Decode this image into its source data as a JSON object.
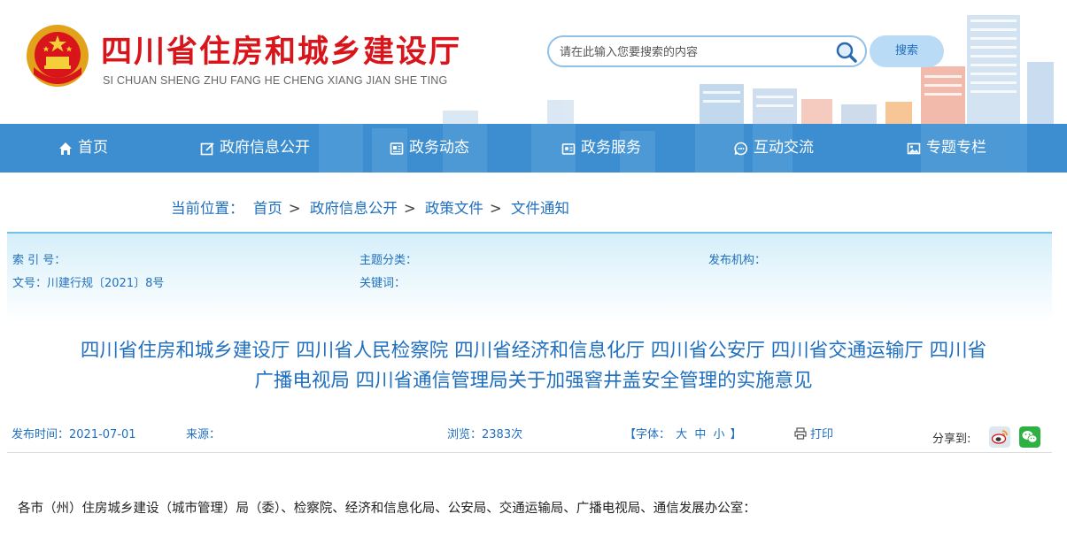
{
  "header": {
    "site_title": "四川省住房和城乡建设厅",
    "site_subtitle": "SI CHUAN SHENG ZHU FANG HE CHENG XIANG JIAN SHE TING",
    "search": {
      "placeholder": "请在此输入您要搜索的内容",
      "button_label": "搜索",
      "icon": "search-icon"
    },
    "emblem_icon": "national-emblem-icon"
  },
  "nav": {
    "items": [
      {
        "label": "首页",
        "icon": "home-icon"
      },
      {
        "label": "政府信息公开",
        "icon": "edit-icon"
      },
      {
        "label": "政务动态",
        "icon": "news-icon"
      },
      {
        "label": "政务服务",
        "icon": "service-icon"
      },
      {
        "label": "互动交流",
        "icon": "chat-icon"
      },
      {
        "label": "专题专栏",
        "icon": "image-icon"
      }
    ],
    "color": "#3c8ed0"
  },
  "breadcrumb": {
    "prefix": "当前位置：",
    "items": [
      "首页",
      "政府信息公开",
      "政策文件",
      "文件通知"
    ],
    "separator": ">"
  },
  "meta": {
    "index_no": "索 引 号：",
    "topic": "主题分类：",
    "publisher": "发布机构：",
    "doc_no": "文号：川建行规〔2021〕8号",
    "keywords": "关键词："
  },
  "document": {
    "title_line1": "四川省住房和城乡建设厅 四川省人民检察院 四川省经济和信息化厅 四川省公安厅 四川省交通运输厅 四川省",
    "title_line2": "广播电视局 四川省通信管理局关于加强窨井盖安全管理的实施意见",
    "publish_time": "发布时间：2021-07-01",
    "source": "来源：",
    "views": "浏览：2383次",
    "font_size_label": "【字体：",
    "font_large": "大",
    "font_medium": "中",
    "font_small": "小",
    "font_size_end": "】",
    "print_label": "打印",
    "share_label": "分享到:",
    "share_icons": [
      "weibo-icon",
      "wechat-icon"
    ],
    "body_first_line": "各市（州）住房城乡建设（城市管理）局（委）、检察院、经济和信息化局、公安局、交通运输局、广播电视局、通信发展办公室："
  },
  "colors": {
    "brand_red": "#d8151b",
    "link_blue": "#1f6fbf",
    "nav_blue": "#3c8ed0"
  }
}
